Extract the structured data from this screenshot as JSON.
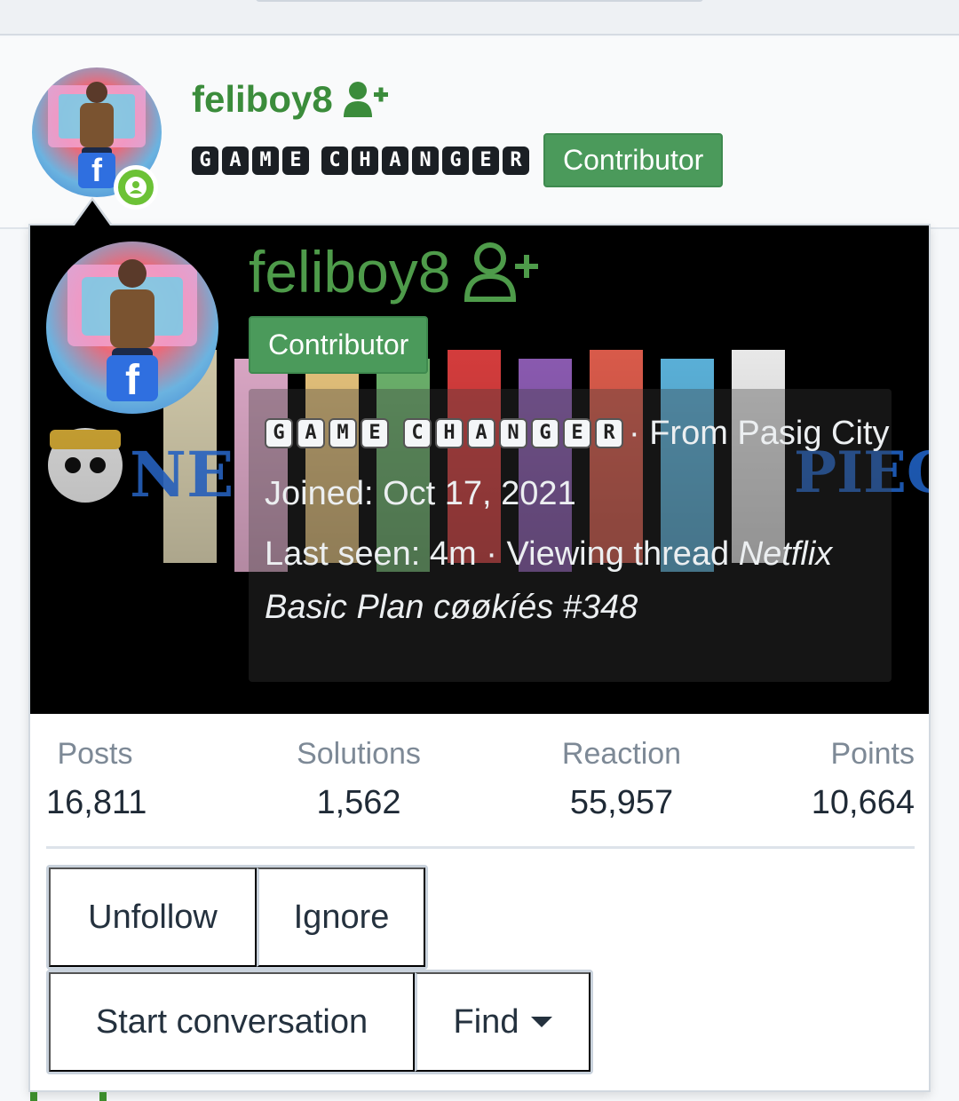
{
  "header": {
    "username": "feliboy8",
    "banner_words": [
      [
        "G",
        "A",
        "M",
        "E"
      ],
      [
        "C",
        "H",
        "A",
        "N",
        "G",
        "E",
        "R"
      ]
    ],
    "role_badge": "Contributor",
    "follow_icon": "user-plus-icon",
    "status_icon": "online-user-icon"
  },
  "card": {
    "username": "feliboy8",
    "follow_icon": "user-plus-outline-icon",
    "role_badge": "Contributor",
    "banner_words": [
      [
        "G",
        "A",
        "M",
        "E"
      ],
      [
        "C",
        "H",
        "A",
        "N",
        "G",
        "E",
        "R"
      ]
    ],
    "from_text": "· From Pasig City",
    "joined_label": "Joined:",
    "joined_value": "Oct 17, 2021",
    "last_seen_label": "Last seen:",
    "last_seen_value": "4m",
    "activity_prefix": "· Viewing thread",
    "thread_title": "Netflix Basic Plan cøøkíés #348"
  },
  "stats": [
    {
      "label": "Posts",
      "value": "16,811"
    },
    {
      "label": "Solutions",
      "value": "1,562"
    },
    {
      "label": "Reaction",
      "value": "55,957"
    },
    {
      "label": "Points",
      "value": "10,664"
    }
  ],
  "actions": {
    "unfollow": "Unfollow",
    "ignore": "Ignore",
    "start_conversation": "Start conversation",
    "find": "Find"
  },
  "colors": {
    "accent_green": "#4b9a5b",
    "username_green": "#3b8c3b",
    "online_green": "#6cc236"
  }
}
